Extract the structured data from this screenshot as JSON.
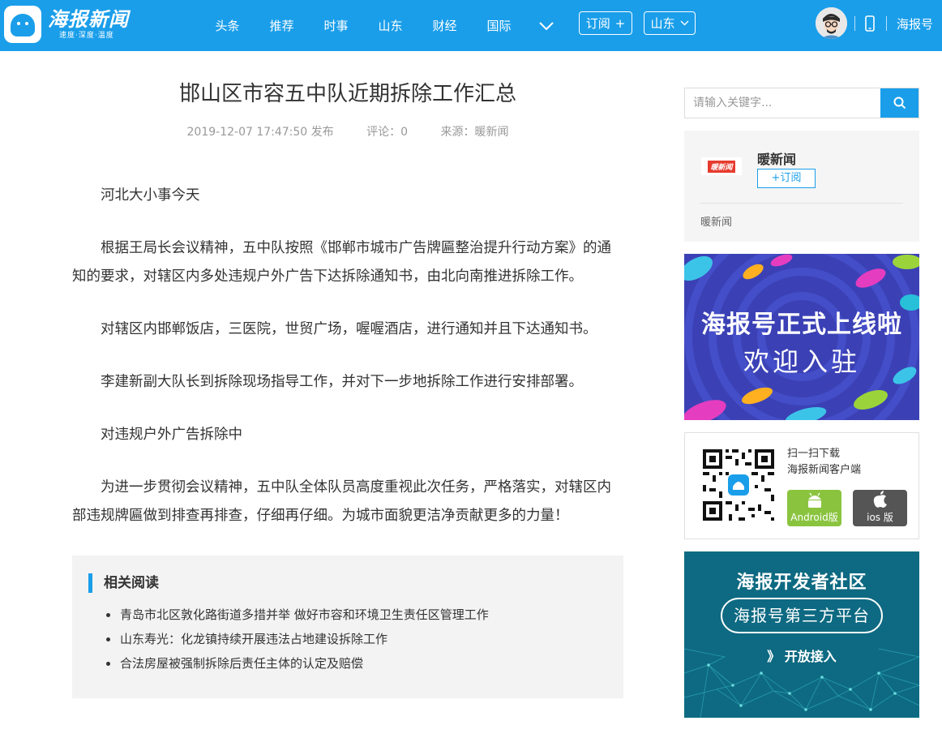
{
  "header": {
    "logo": {
      "title": "海报新闻",
      "slogan": "速度·深度·温度"
    },
    "nav": [
      "头条",
      "推荐",
      "时事",
      "山东",
      "财经",
      "国际"
    ],
    "more_icon": "chevron-down-icon",
    "subscribe_label": "订阅",
    "subscribe_plus": "+",
    "region_label": "山东",
    "user_avatar_icon": "avatar-icon",
    "phone_icon": "mobile-phone-icon",
    "haibao_label": "海报号",
    "colors": {
      "brand": "#1a9eea"
    }
  },
  "article": {
    "title": "邯山区市容五中队近期拆除工作汇总",
    "published": "2019-12-07 17:47:50 发布",
    "comments": "评论：0",
    "source": "来源：暖新闻",
    "paragraphs": [
      "河北大小事今天",
      "根据王局长会议精神，五中队按照《邯郸市城市广告牌匾整治提升行动方案》的通知的要求，对辖区内多处违规户外广告下达拆除通知书，由北向南推进拆除工作。",
      "对辖区内邯郸饭店，三医院，世贸广场，喔喔酒店，进行通知并且下达通知书。",
      "李建新副大队长到拆除现场指导工作，并对下一步地拆除工作进行安排部署。",
      "对违规户外广告拆除中",
      "为进一步贯彻会议精神，五中队全体队员高度重视此次任务，严格落实，对辖区内部违规牌匾做到排查再排查，仔细再仔细。为城市面貌更洁净贡献更多的力量！"
    ]
  },
  "related": {
    "heading": "相关阅读",
    "items": [
      "青岛市北区敦化路街道多措并举 做好市容和环境卫生责任区管理工作",
      "山东寿光：化龙镇持续开展违法占地建设拆除工作",
      "合法房屋被强制拆除后责任主体的认定及赔偿"
    ]
  },
  "sidebar": {
    "search": {
      "placeholder": "请输入关键字...",
      "icon": "search-icon"
    },
    "source_card": {
      "logo_text": "暖新闻",
      "name": "暖新闻",
      "subscribe": "+订阅",
      "description": "暖新闻"
    },
    "banner1": {
      "line1": "海报号正式上线啦",
      "line2": "欢迎入驻"
    },
    "app": {
      "line1": "扫一扫下载",
      "line2": "海报新闻客户端",
      "android": "Android版",
      "ios": "ios 版"
    },
    "banner2": {
      "title": "海报开发者社区",
      "pill": "海报号第三方平台",
      "enter": "》 开放接入"
    }
  }
}
